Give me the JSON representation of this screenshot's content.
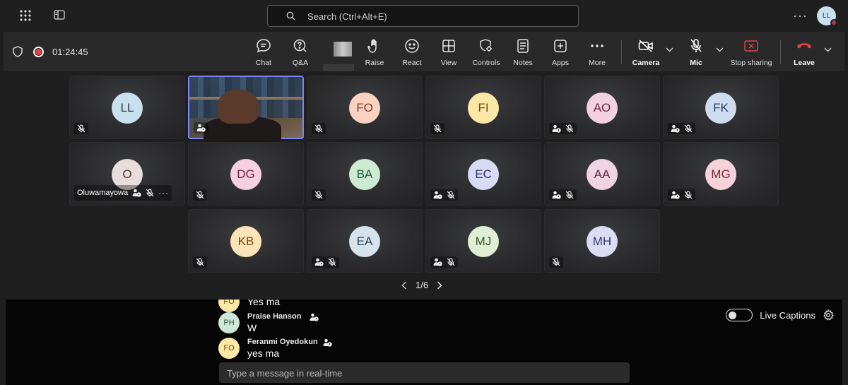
{
  "search": {
    "placeholder": "Search (Ctrl+Alt+E)"
  },
  "user": {
    "initials": "LL"
  },
  "meeting": {
    "timer": "01:24:45"
  },
  "toolbar": {
    "chat": "Chat",
    "qa": "Q&A",
    "raise": "Raise",
    "react": "React",
    "view": "View",
    "controls": "Controls",
    "notes": "Notes",
    "apps": "Apps",
    "more": "More",
    "camera": "Camera",
    "mic": "Mic",
    "stop_sharing": "Stop sharing",
    "leave": "Leave"
  },
  "colors": {
    "leave": "#e0464a",
    "stop_sharing": "#c4314b",
    "highlight_border": "#7f85f5"
  },
  "participants": [
    {
      "initials": "LL",
      "bg": "#c9e1ee",
      "fg": "#2a3e4a",
      "icons": [
        "mic-off"
      ]
    },
    {
      "initials": "",
      "video": true,
      "icons": [
        "guest"
      ]
    },
    {
      "initials": "FO",
      "bg": "#fad2c0",
      "fg": "#7a3920",
      "icons": [
        "mic-off"
      ]
    },
    {
      "initials": "FI",
      "bg": "#fbe8a6",
      "fg": "#6b5208",
      "icons": [
        "mic-off"
      ]
    },
    {
      "initials": "AO",
      "bg": "#f3d1de",
      "fg": "#6e2842",
      "icons": [
        "guest",
        "mic-off"
      ]
    },
    {
      "initials": "FK",
      "bg": "#cfdcef",
      "fg": "#263c62",
      "icons": [
        "guest",
        "mic-off"
      ]
    },
    {
      "initials": "O",
      "bg": "#e8dcdc",
      "fg": "#4a3a3a",
      "name": "Oluwamayowa",
      "icons": [
        "guest",
        "mic-off",
        "more"
      ]
    },
    {
      "initials": "DG",
      "bg": "#f6cfe0",
      "fg": "#6e2444",
      "icons": [
        "mic-off"
      ]
    },
    {
      "initials": "BA",
      "bg": "#cdebd3",
      "fg": "#23583a",
      "icons": [
        "mic-off"
      ]
    },
    {
      "initials": "EC",
      "bg": "#d9dbf5",
      "fg": "#33356e",
      "icons": [
        "guest",
        "mic-off"
      ]
    },
    {
      "initials": "AA",
      "bg": "#f0d4e1",
      "fg": "#5e2a44",
      "icons": [
        "guest",
        "mic-off"
      ]
    },
    {
      "initials": "MG",
      "bg": "#f7d2db",
      "fg": "#6b2839",
      "icons": [
        "guest",
        "mic-off"
      ]
    },
    {
      "initials": "KB",
      "bg": "#fde4b8",
      "fg": "#6b4a10",
      "icons": [
        "mic-off"
      ]
    },
    {
      "initials": "EA",
      "bg": "#d6e3ec",
      "fg": "#2c4556",
      "icons": [
        "guest",
        "mic-off"
      ]
    },
    {
      "initials": "MJ",
      "bg": "#e0eed6",
      "fg": "#3c5628",
      "icons": [
        "guest",
        "mic-off"
      ]
    },
    {
      "initials": "MH",
      "bg": "#dcdcf5",
      "fg": "#34356e",
      "icons": [
        "mic-off"
      ]
    }
  ],
  "pager": {
    "page": "1/6"
  },
  "chat": [
    {
      "initials": "FO",
      "author": "",
      "text": "Yes ma",
      "bg": "#fbe8a6",
      "fg": "#6b5208"
    },
    {
      "initials": "PH",
      "author": "Praise Hanson",
      "text": "W",
      "bg": "#cfe6d9",
      "fg": "#2c5a40"
    },
    {
      "initials": "FO",
      "author": "Feranmi Oyedokun",
      "text": "yes ma",
      "bg": "#fbe8a6",
      "fg": "#6b5208"
    }
  ],
  "captions": {
    "live_label": "Live Captions"
  },
  "composer": {
    "placeholder": "Type a message in real-time"
  }
}
